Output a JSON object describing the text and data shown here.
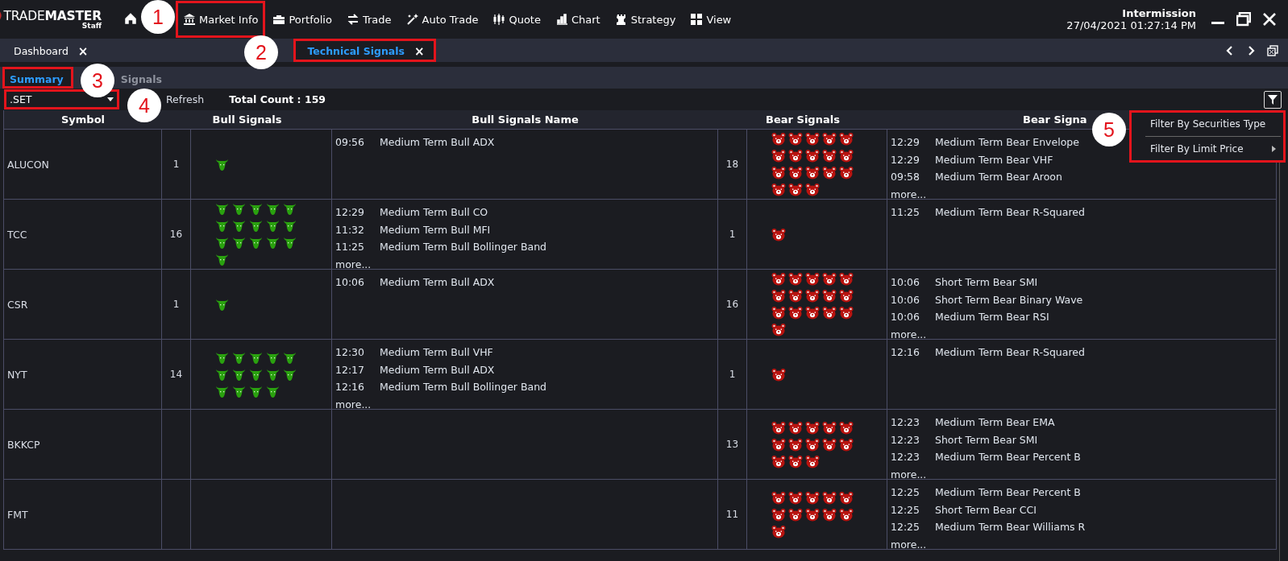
{
  "app": {
    "logo": "TRADE**MASTER**",
    "logo_sub": "Staff"
  },
  "menu": [
    {
      "label": "Market Info",
      "annotated": true
    },
    {
      "label": "Portfolio",
      "annotated": false
    },
    {
      "label": "Trade",
      "annotated": false
    },
    {
      "label": "Auto Trade",
      "annotated": false
    },
    {
      "label": "Quote",
      "annotated": false
    },
    {
      "label": "Chart",
      "annotated": false
    },
    {
      "label": "Strategy",
      "annotated": false
    },
    {
      "label": "View",
      "annotated": false
    }
  ],
  "status": {
    "session": "Intermission",
    "datetime": "27/04/2021 01:27:14 PM"
  },
  "tabs": [
    {
      "label": "Dashboard",
      "close_label": "×",
      "selected": false,
      "annotated": false
    },
    {
      "label": "Technical Signals",
      "close_label": "×",
      "selected": true,
      "annotated": true
    }
  ],
  "subtabs": [
    {
      "label": "Summary",
      "selected": true,
      "annotated": true
    },
    {
      "label": "Signals",
      "selected": false,
      "annotated": false
    }
  ],
  "toolbar": {
    "market": ".SET",
    "market_annotated": true,
    "refresh": "Refresh",
    "total_count": "Total Count : 159"
  },
  "filter_menu": {
    "annotated": true,
    "items": [
      {
        "label": "Filter By Securities Type",
        "has_submenu": false
      },
      {
        "label": "Filter By Limit Price",
        "has_submenu": true
      }
    ]
  },
  "table": {
    "columns": [
      "Symbol",
      "Bull Signals",
      "Bull Signals Name",
      "Bear Signals",
      "Bear Signa"
    ],
    "rows": [
      {
        "symbol": "ALUCON",
        "bull_count": "1",
        "bull_signals": [
          {
            "time": "09:56",
            "name": "Medium Term Bull ADX"
          }
        ],
        "bear_count": "18",
        "bear_signals": [
          {
            "time": "12:29",
            "name": "Medium Term Bear Envelope"
          },
          {
            "time": "12:29",
            "name": "Medium Term Bear VHF"
          },
          {
            "time": "09:58",
            "name": "Medium Term Bear Aroon"
          }
        ],
        "bear_more": "more..."
      },
      {
        "symbol": "TCC",
        "bull_count": "16",
        "bull_signals": [
          {
            "time": "12:29",
            "name": "Medium Term Bull CO"
          },
          {
            "time": "11:32",
            "name": "Medium Term Bull MFI"
          },
          {
            "time": "11:25",
            "name": "Medium Term Bull Bollinger Band"
          }
        ],
        "bull_more": "more...",
        "bear_count": "1",
        "bear_signals": [
          {
            "time": "11:25",
            "name": "Medium Term Bear R-Squared"
          }
        ]
      },
      {
        "symbol": "CSR",
        "bull_count": "1",
        "bull_signals": [
          {
            "time": "10:06",
            "name": "Medium Term Bull ADX"
          }
        ],
        "bear_count": "16",
        "bear_signals": [
          {
            "time": "10:06",
            "name": "Short Term Bear SMI"
          },
          {
            "time": "10:06",
            "name": "Short Term Bear Binary Wave"
          },
          {
            "time": "10:06",
            "name": "Medium Term Bear RSI"
          }
        ],
        "bear_more": "more..."
      },
      {
        "symbol": "NYT",
        "bull_count": "14",
        "bull_signals": [
          {
            "time": "12:30",
            "name": "Medium Term Bull VHF"
          },
          {
            "time": "12:17",
            "name": "Medium Term Bull ADX"
          },
          {
            "time": "12:16",
            "name": "Medium Term Bull Bollinger Band"
          }
        ],
        "bull_more": "more...",
        "bear_count": "1",
        "bear_signals": [
          {
            "time": "12:16",
            "name": "Medium Term Bear R-Squared"
          }
        ]
      },
      {
        "symbol": "BKKCP",
        "bear_count": "13",
        "bear_signals": [
          {
            "time": "12:23",
            "name": "Medium Term Bear EMA"
          },
          {
            "time": "12:23",
            "name": "Short Term Bear SMI"
          },
          {
            "time": "12:23",
            "name": "Medium Term Bear Percent B"
          }
        ],
        "bear_more": "more..."
      },
      {
        "symbol": "FMT",
        "bear_count": "11",
        "bear_signals": [
          {
            "time": "12:25",
            "name": "Medium Term Bear Percent B"
          },
          {
            "time": "12:25",
            "name": "Short Term Bear CCI"
          },
          {
            "time": "12:25",
            "name": "Medium Term Bear Williams R"
          }
        ],
        "bear_more": "more..."
      }
    ]
  },
  "annotations": [
    {
      "number": "1"
    },
    {
      "number": "2"
    },
    {
      "number": "3"
    },
    {
      "number": "4"
    },
    {
      "number": "5"
    }
  ]
}
